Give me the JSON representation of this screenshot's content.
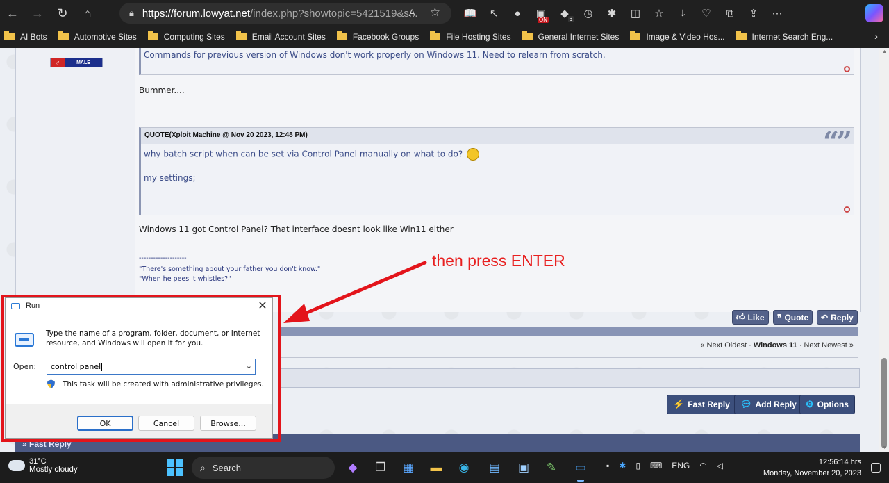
{
  "browser": {
    "url_host": "https://forum.lowyat.net",
    "url_path": "/index.php?showtopic=5421519&s...",
    "reader_label": "A",
    "extensions": [
      {
        "name": "reading-icon",
        "glyph": "📖"
      },
      {
        "name": "cursor-icon",
        "glyph": "↖"
      },
      {
        "name": "pool-ball-icon",
        "glyph": "●"
      },
      {
        "name": "on-extension-icon",
        "glyph": "▣",
        "badge": "ON"
      },
      {
        "name": "extension-count-icon",
        "glyph": "◆",
        "badge": "6"
      },
      {
        "name": "clock-extension-icon",
        "glyph": "◷",
        "badge": ""
      },
      {
        "name": "puzzle-icon",
        "glyph": "✱",
        "badge": ""
      },
      {
        "name": "split-screen-icon",
        "glyph": "◫",
        "badge": ""
      },
      {
        "name": "favorites-icon",
        "glyph": "☆",
        "badge": ""
      },
      {
        "name": "downloads-icon",
        "glyph": "⤓",
        "badge": ""
      },
      {
        "name": "health-icon",
        "glyph": "♡",
        "badge": ""
      },
      {
        "name": "collections-icon",
        "glyph": "⧉",
        "badge": ""
      },
      {
        "name": "share-icon",
        "glyph": "⇪",
        "badge": ""
      },
      {
        "name": "more-icon",
        "glyph": "⋯",
        "badge": ""
      }
    ]
  },
  "bookmarks": [
    "AI Bots",
    "Automotive Sites",
    "Computing Sites",
    "Email Account Sites",
    "Facebook Groups",
    "File Hosting Sites",
    "General Internet Sites",
    "Image & Video Hos...",
    "Internet Search Eng..."
  ],
  "post": {
    "gender_symbol": "♂",
    "gender_label": "MALE",
    "quote1_text": "Commands for previous version of Windows don't work properly on Windows 11. Need to relearn from scratch.",
    "reply1": "Bummer....",
    "quote2_header": "QUOTE(Xploit Machine @ Nov 20 2023, 12:48 PM)",
    "quote2_mark": "“”",
    "quote2_line1": "why batch script when can be set via Control Panel manually on what to do?",
    "quote2_line2": "my settings;",
    "reply2": "Windows 11 got Control Panel? That interface doesnt look like Win11 either",
    "sig_divider": "--------------------",
    "sig_line1": "\"There's something about your father you don't know.\"",
    "sig_line2": "\"When he pees it whistles?\""
  },
  "post_buttons": {
    "like": "Like",
    "quote": "Quote",
    "reply": "Reply"
  },
  "topic_nav": {
    "prev": "« Next Oldest",
    "sep": "·",
    "current": "Windows 11",
    "next": "Next Newest »"
  },
  "actions": {
    "fast_reply": "Fast Reply",
    "add_reply": "Add Reply",
    "options": "Options"
  },
  "fast_reply_bar": "» Fast Reply",
  "annotation": {
    "callout": "then press ENTER",
    "color": "#e82020"
  },
  "run_dialog": {
    "title": "Run",
    "close": "✕",
    "description": "Type the name of a program, folder, document, or Internet resource, and Windows will open it for you.",
    "open_label": "Open:",
    "open_value": "control panel",
    "admin_note": "This task will be created with administrative privileges.",
    "ok": "OK",
    "cancel": "Cancel",
    "browse": "Browse..."
  },
  "taskbar": {
    "weather_temp": "31°C",
    "weather_desc": "Mostly cloudy",
    "search_label": "Search",
    "tray_language": "ENG",
    "time": "12:56:14 hrs",
    "date": "Monday, November 20, 2023"
  }
}
